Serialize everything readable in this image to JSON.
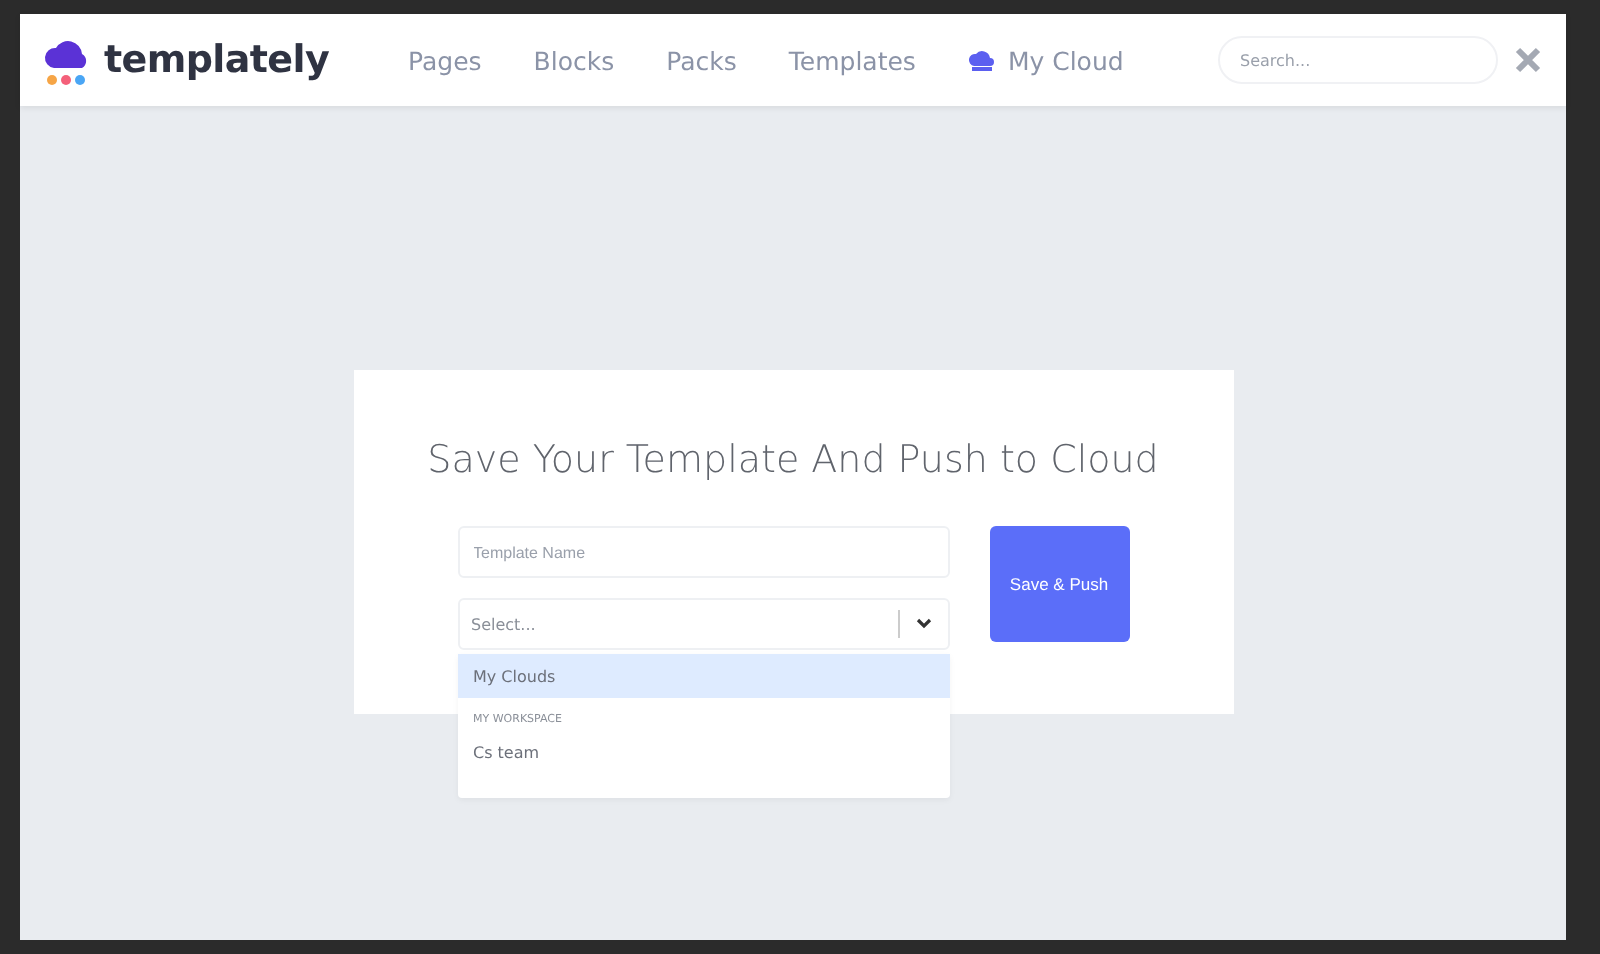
{
  "header": {
    "logo": "templately",
    "nav": [
      {
        "label": "Pages",
        "kind": "text",
        "selected": false
      },
      {
        "label": "Blocks",
        "kind": "text",
        "selected": false
      },
      {
        "label": "Packs",
        "kind": "text",
        "selected": false
      },
      {
        "label": "Templates",
        "kind": "text",
        "selected": false
      },
      {
        "label": "My Cloud",
        "kind": "cloud",
        "selected": false
      }
    ],
    "search": {
      "placeholder": "Search..."
    }
  },
  "dialog": {
    "title": "Save Your Template And Push to Cloud",
    "name_field": {
      "placeholder": "Template Name"
    },
    "select": {
      "placeholder": "Select...",
      "expanded": true
    },
    "options": [
      {
        "kind": "option",
        "label": "My Clouds",
        "selected": true
      },
      {
        "kind": "group",
        "label": "MY WORKSPACE"
      },
      {
        "kind": "option",
        "label": "Cs team",
        "selected": false
      }
    ],
    "button": "Save & Push"
  }
}
